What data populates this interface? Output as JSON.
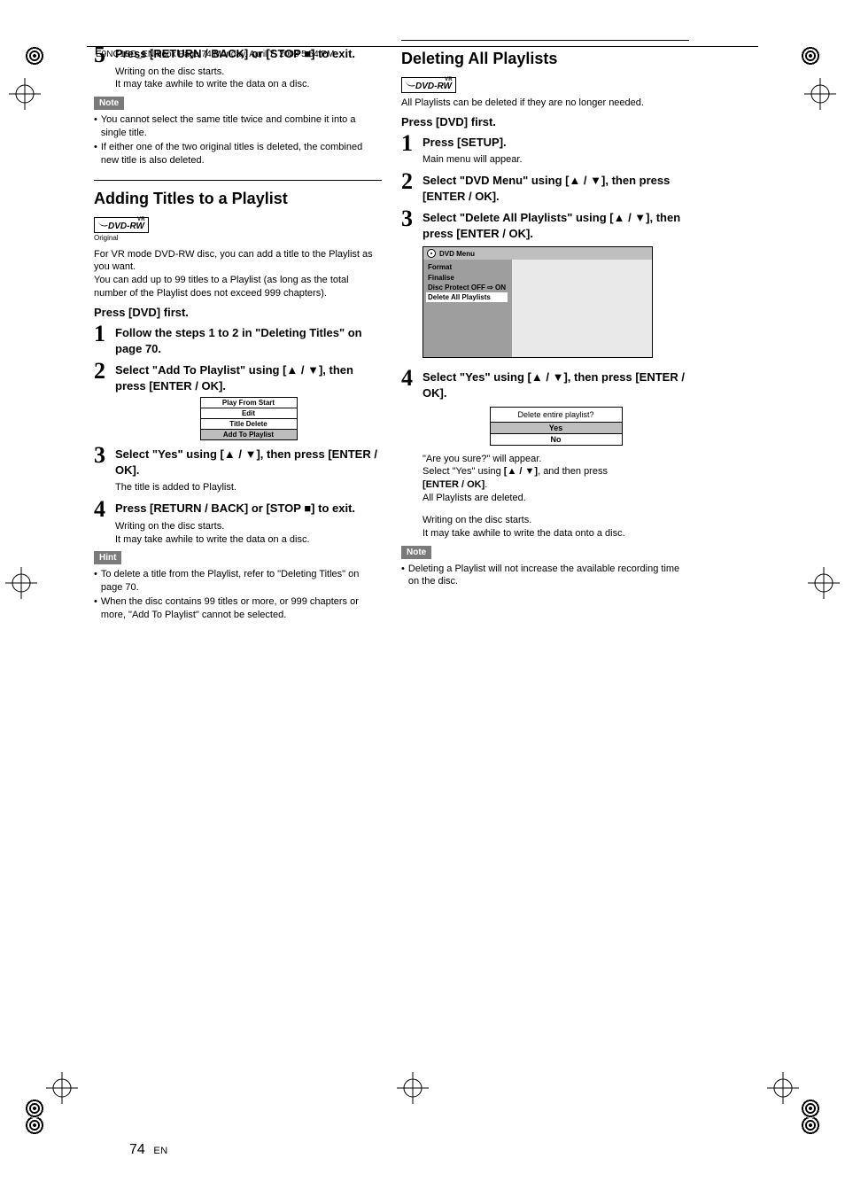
{
  "header": {
    "runner": "E9NG1BD_EN.book  Page 74  Monday, April 7, 2008  5:54 PM"
  },
  "footer": {
    "page": "74",
    "lang": "EN"
  },
  "col1": {
    "step5": {
      "num": "5",
      "head": "Press [RETURN / BACK] or [STOP ■] to exit.",
      "line1": "Writing on the disc starts.",
      "line2": "It may take awhile to write the data on a disc."
    },
    "noteLabel": "Note",
    "notes": [
      "You cannot select the same title twice and combine it into a single title.",
      "If either one of the two original titles is deleted, the combined new title is also deleted."
    ],
    "section1": {
      "title": "Adding Titles to a Playlist",
      "badge": "DVD-RW",
      "badgeSup": "VR",
      "badgeCaption": "Original",
      "intro1": "For VR mode DVD-RW disc, you can add a title to the Playlist as you want.",
      "intro2": "You can add up to 99 titles to a Playlist (as long as the total number of the Playlist does not exceed 999 chapters).",
      "pre": "Press [DVD] first.",
      "step1": {
        "num": "1",
        "head": "Follow the steps 1 to 2 in \"Deleting Titles\" on page 70."
      },
      "step2": {
        "num": "2",
        "head": "Select \"Add To Playlist\" using [▲ / ▼], then press [ENTER / OK].",
        "menu": [
          "Play From Start",
          "Edit",
          "Title Delete",
          "Add To Playlist"
        ],
        "menuHighlightIndex": 3
      },
      "step3": {
        "num": "3",
        "head": "Select \"Yes\" using [▲ / ▼], then press [ENTER / OK].",
        "text": "The title is added to Playlist."
      },
      "step4": {
        "num": "4",
        "head": "Press [RETURN / BACK] or [STOP ■] to exit.",
        "line1": "Writing on the disc starts.",
        "line2": "It may take awhile to write the data on a disc."
      },
      "hintLabel": "Hint",
      "hints": [
        "To delete a title from the Playlist, refer to \"Deleting Titles\" on page 70.",
        "When the disc contains 99 titles or more, or 999 chapters or more, \"Add To Playlist\" cannot be selected."
      ]
    }
  },
  "col2": {
    "section": {
      "title": "Deleting All Playlists",
      "badge": "DVD-RW",
      "badgeSup": "VR",
      "intro": "All Playlists can be deleted if they are no longer needed.",
      "pre": "Press [DVD] first.",
      "step1": {
        "num": "1",
        "head": "Press [SETUP].",
        "text": "Main menu will appear."
      },
      "step2": {
        "num": "2",
        "head": "Select \"DVD Menu\" using [▲ / ▼], then press [ENTER / OK]."
      },
      "step3": {
        "num": "3",
        "head": "Select \"Delete All Playlists\" using [▲ / ▼], then press [ENTER / OK].",
        "tvHeader": "DVD Menu",
        "tvItems": [
          "Format",
          "Finalise",
          "Disc Protect OFF ⇨ ON",
          "Delete All Playlists"
        ],
        "tvHighlightIndex": 3
      },
      "step4": {
        "num": "4",
        "head": "Select \"Yes\" using [▲ / ▼], then press [ENTER / OK].",
        "dialogTitle": "Delete entire playlist?",
        "dialogYes": "Yes",
        "dialogNo": "No",
        "after1a": "\"Are you sure?\" will appear.",
        "after1b": "Select \"Yes\" using ",
        "after1b_keys": "[▲ / ▼]",
        "after1c": ", and then press ",
        "after1d": "[ENTER / OK]",
        "after1e": ".",
        "after2": "All Playlists are deleted.",
        "after3": "Writing on the disc starts.",
        "after4": "It may take awhile to write the data onto a disc."
      },
      "noteLabel": "Note",
      "notes": [
        "Deleting a Playlist will not increase the available recording time on the disc."
      ]
    }
  }
}
